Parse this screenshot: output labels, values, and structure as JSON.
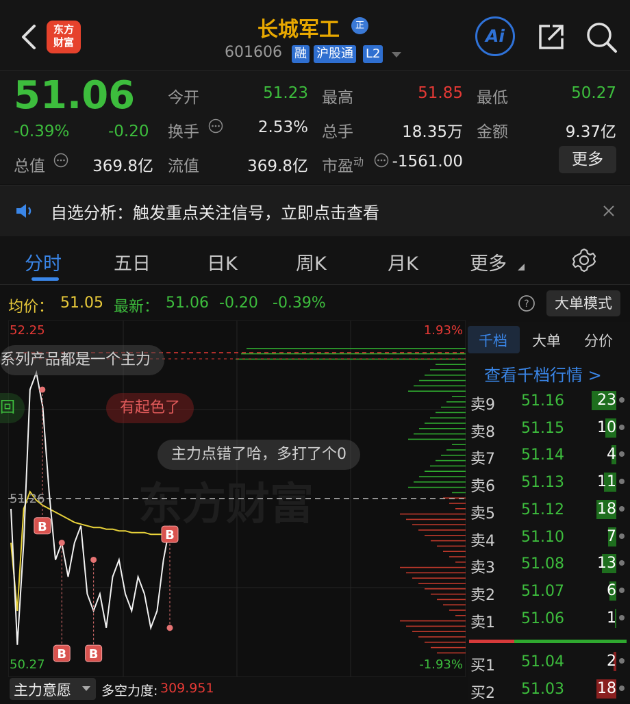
{
  "header": {
    "logo_line1": "东方",
    "logo_line2": "财富",
    "stock_name": "长城军工",
    "name_badge": "正",
    "stock_code": "601606",
    "tags": [
      "融",
      "沪股通",
      "L2"
    ],
    "ai_label": "Ai"
  },
  "quote": {
    "price": "51.06",
    "change_pct": "-0.39%",
    "change": "-0.20",
    "open_label": "今开",
    "open": "51.23",
    "high_label": "最高",
    "high": "51.85",
    "low_label": "最低",
    "low": "50.27",
    "turnover_label": "换手",
    "turnover": "2.53%",
    "volume_label": "总手",
    "volume": "18.35万",
    "amount_label": "金额",
    "amount": "9.37亿",
    "mktcap_label": "总值",
    "mktcap": "369.8亿",
    "float_label": "流值",
    "float_cap": "369.8亿",
    "pe_label": "市盈",
    "pe_sup": "动",
    "pe": "-1561.00",
    "more_button": "更多"
  },
  "notice": {
    "text": "自选分析：触发重点关注信号，立即点击查看"
  },
  "tabs": [
    {
      "label": "分时",
      "active": true
    },
    {
      "label": "五日",
      "active": false
    },
    {
      "label": "日K",
      "active": false
    },
    {
      "label": "周K",
      "active": false
    },
    {
      "label": "月K",
      "active": false
    },
    {
      "label": "更多",
      "active": false
    }
  ],
  "infoline": {
    "avg_label": "均价：",
    "avg_value": "51.05",
    "latest_label": "最新：",
    "latest_value": "51.06",
    "latest_change": "-0.20",
    "latest_pct": "-0.39%",
    "mode_button": "大单模式"
  },
  "chart": {
    "price_high": "52.25",
    "price_low": "50.27",
    "pct_high": "1.93%",
    "pct_low": "-1.93%",
    "prev_close_label": "51.26",
    "watermark": "东方财富",
    "marker_label": "B",
    "bubbles": [
      "系列产品都是一个主力",
      "回",
      "有起色了",
      "主力点错了哈，多打了个0"
    ],
    "bottom_selector": "主力意愿",
    "bottom_metric_label": "多空力度:",
    "bottom_metric_value": "309.951"
  },
  "chart_data": {
    "type": "line",
    "title": "",
    "ylim": [
      50.27,
      52.25
    ],
    "prev_close": 51.26,
    "series": [
      {
        "values": [
          51.2,
          50.4,
          51.0,
          51.9,
          52.0,
          51.8,
          51.3,
          50.9,
          51.0,
          50.8,
          51.0,
          51.1,
          50.7,
          50.6,
          50.7,
          50.5,
          50.8,
          50.9,
          50.7,
          50.6,
          50.8,
          50.7,
          50.5,
          50.6,
          50.9,
          51.1
        ]
      },
      {
        "values": [
          51.0,
          50.6,
          51.2,
          51.3,
          51.25,
          51.22,
          51.2,
          51.18,
          51.16,
          51.14,
          51.12,
          51.11,
          51.1,
          51.09,
          51.09,
          51.08,
          51.08,
          51.07,
          51.07,
          51.06,
          51.06,
          51.06,
          51.05,
          51.05,
          51.05,
          51.05
        ]
      }
    ]
  },
  "orderbook": {
    "tabs": [
      "千档",
      "大单",
      "分价"
    ],
    "link": "查看千档行情 >",
    "asks": [
      {
        "label": "卖9",
        "price": "51.16",
        "vol": "23",
        "frac": 1.0
      },
      {
        "label": "卖8",
        "price": "51.15",
        "vol": "10",
        "frac": 0.45
      },
      {
        "label": "卖7",
        "price": "51.14",
        "vol": "4",
        "frac": 0.2
      },
      {
        "label": "卖6",
        "price": "51.13",
        "vol": "11",
        "frac": 0.5
      },
      {
        "label": "卖5",
        "price": "51.12",
        "vol": "18",
        "frac": 0.8
      },
      {
        "label": "卖4",
        "price": "51.10",
        "vol": "7",
        "frac": 0.32
      },
      {
        "label": "卖3",
        "price": "51.08",
        "vol": "13",
        "frac": 0.58
      },
      {
        "label": "卖2",
        "price": "51.07",
        "vol": "6",
        "frac": 0.28
      },
      {
        "label": "卖1",
        "price": "51.06",
        "vol": "1",
        "frac": 0.05
      }
    ],
    "bids": [
      {
        "label": "买1",
        "price": "51.04",
        "vol": "2",
        "frac": 0.1
      },
      {
        "label": "买2",
        "price": "51.03",
        "vol": "18",
        "frac": 0.8
      }
    ]
  }
}
